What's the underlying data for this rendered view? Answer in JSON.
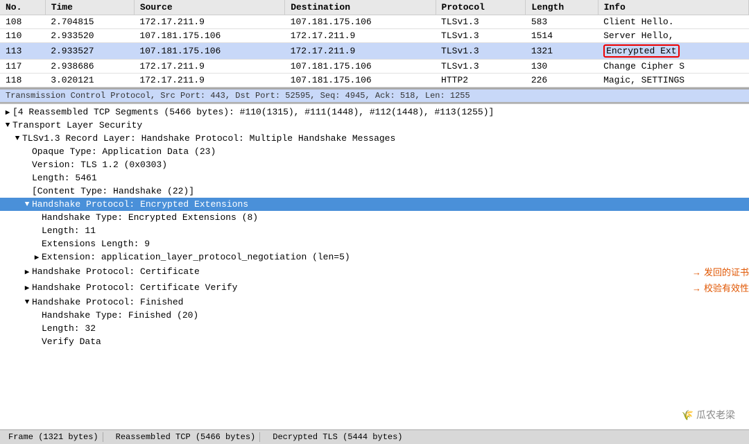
{
  "table": {
    "columns": [
      "No.",
      "Time",
      "Source",
      "Destination",
      "Protocol",
      "Length",
      "Info"
    ],
    "rows": [
      {
        "no": "108",
        "time": "2.704815",
        "source": "172.17.211.9",
        "destination": "107.181.175.106",
        "protocol": "TLSv1.3",
        "length": "583",
        "info": "Client Hello.",
        "selected": false,
        "highlight": false
      },
      {
        "no": "110",
        "time": "2.933520",
        "source": "107.181.175.106",
        "destination": "172.17.211.9",
        "protocol": "TLSv1.3",
        "length": "1514",
        "info": "Server Hello,",
        "selected": false,
        "highlight": false
      },
      {
        "no": "113",
        "time": "2.933527",
        "source": "107.181.175.106",
        "destination": "172.17.211.9",
        "protocol": "TLSv1.3",
        "length": "1321",
        "info": "Encrypted Ext",
        "selected": true,
        "highlight": true
      },
      {
        "no": "117",
        "time": "2.938686",
        "source": "172.17.211.9",
        "destination": "107.181.175.106",
        "protocol": "TLSv1.3",
        "length": "130",
        "info": "Change Cipher S",
        "selected": false,
        "highlight": false
      },
      {
        "no": "118",
        "time": "3.020121",
        "source": "172.17.211.9",
        "destination": "107.181.175.106",
        "protocol": "HTTP2",
        "length": "226",
        "info": "Magic, SETTINGS",
        "selected": false,
        "highlight": false
      }
    ]
  },
  "tcp_bar": "Transmission Control Protocol, Src Port: 443, Dst Port: 52595, Seq: 4945, Ack: 518, Len: 1255",
  "reassembled_bar": "[4 Reassembled TCP Segments (5466 bytes): #110(1315), #111(1448), #112(1448), #113(1255)]",
  "detail": {
    "sections": [
      {
        "id": "reassembled",
        "indent": 0,
        "arrow": "▶",
        "label": "[4 Reassembled TCP Segments (5466 bytes): #110(1315), #111(1448), #112(1448), #113(1255)]",
        "expanded": false
      },
      {
        "id": "tls-root",
        "indent": 0,
        "arrow": "▼",
        "label": "Transport Layer Security",
        "expanded": true
      },
      {
        "id": "tls-record",
        "indent": 1,
        "arrow": "▼",
        "label": "TLSv1.3 Record Layer: Handshake Protocol: Multiple Handshake Messages",
        "expanded": true
      },
      {
        "id": "opaque-type",
        "indent": 2,
        "arrow": "",
        "label": "Opaque Type: Application Data (23)"
      },
      {
        "id": "version",
        "indent": 2,
        "arrow": "",
        "label": "Version: TLS 1.2 (0x0303)"
      },
      {
        "id": "length-5461",
        "indent": 2,
        "arrow": "",
        "label": "Length: 5461"
      },
      {
        "id": "content-type",
        "indent": 2,
        "arrow": "",
        "label": "[Content Type: Handshake (22)]"
      },
      {
        "id": "hs-encrypted-ext",
        "indent": 2,
        "arrow": "▼",
        "label": "Handshake Protocol: Encrypted Extensions",
        "expanded": true,
        "selected": true
      },
      {
        "id": "hs-type",
        "indent": 3,
        "arrow": "",
        "label": "Handshake Type: Encrypted Extensions (8)"
      },
      {
        "id": "hs-length",
        "indent": 3,
        "arrow": "",
        "label": "Length: 11"
      },
      {
        "id": "ext-length",
        "indent": 3,
        "arrow": "",
        "label": "Extensions Length: 9"
      },
      {
        "id": "ext-alpn",
        "indent": 3,
        "arrow": "▶",
        "label": "Extension: application_layer_protocol_negotiation (len=5)"
      },
      {
        "id": "hs-cert",
        "indent": 2,
        "arrow": "▶",
        "label": "Handshake Protocol: Certificate",
        "annotation": "发回的证书",
        "hasAnnotation": true
      },
      {
        "id": "hs-cert-verify",
        "indent": 2,
        "arrow": "▶",
        "label": "Handshake Protocol: Certificate Verify",
        "annotation": "校验有效性",
        "hasAnnotation": true
      },
      {
        "id": "hs-finished",
        "indent": 2,
        "arrow": "▼",
        "label": "Handshake Protocol: Finished",
        "expanded": true
      },
      {
        "id": "hs-finished-type",
        "indent": 3,
        "arrow": "",
        "label": "Handshake Type: Finished (20)"
      },
      {
        "id": "hs-finished-length",
        "indent": 3,
        "arrow": "",
        "label": "Length: 32"
      },
      {
        "id": "verify-data",
        "indent": 3,
        "arrow": "",
        "label": "Verify Data"
      }
    ]
  },
  "status_bar": {
    "items": [
      "Frame (1321 bytes)",
      "Reassembled TCP (5466 bytes)",
      "Decrypted TLS (5444 bytes)"
    ]
  },
  "watermark": "瓜农老梁"
}
